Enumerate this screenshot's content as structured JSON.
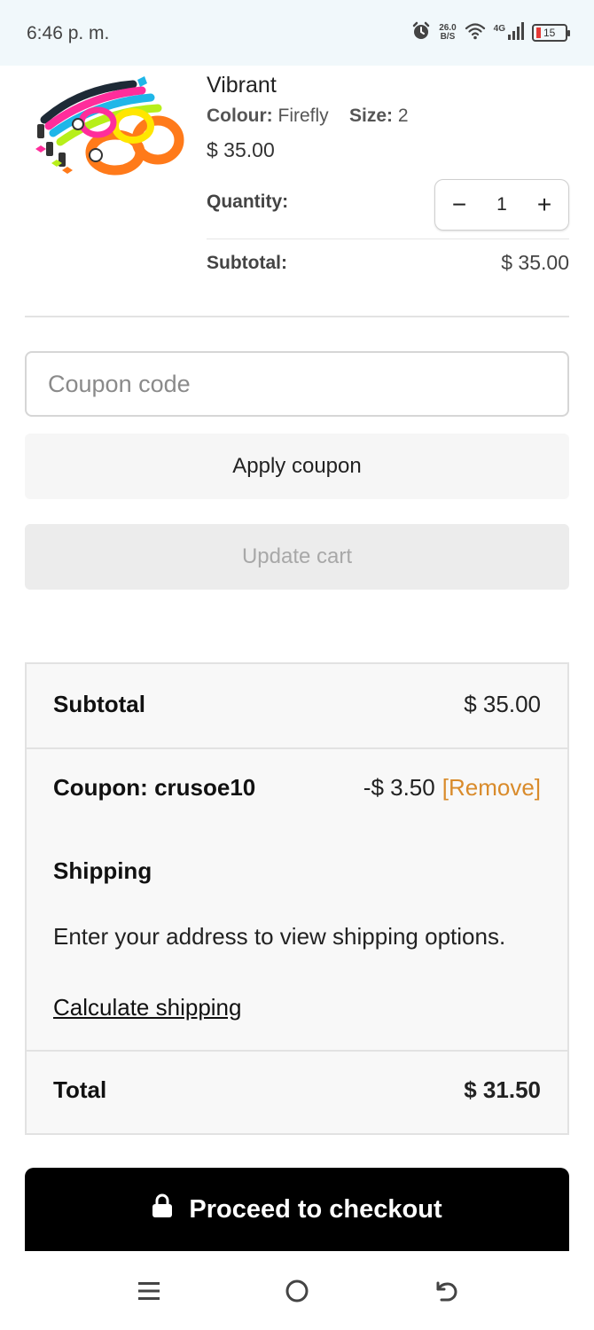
{
  "status_bar": {
    "time": "6:46 p. m.",
    "net_speed_value": "26.0",
    "net_speed_unit": "B/S",
    "network_type": "4G",
    "battery_level": "15",
    "battery_color": "#e53935"
  },
  "product": {
    "name": "Vibrant",
    "colour_label": "Colour:",
    "colour_value": "Firefly",
    "size_label": "Size:",
    "size_value": "2",
    "price": "$ 35.00",
    "quantity_label": "Quantity:",
    "quantity_value": "1",
    "decrement_symbol": "−",
    "increment_symbol": "+",
    "subtotal_label": "Subtotal:",
    "subtotal_value": "$ 35.00"
  },
  "coupon": {
    "placeholder": "Coupon code",
    "apply_label": "Apply coupon"
  },
  "update_cart_label": "Update cart",
  "totals": {
    "subtotal_label": "Subtotal",
    "subtotal_value": "$ 35.00",
    "coupon_label": "Coupon: crusoe10",
    "coupon_value": "-$ 3.50",
    "remove_label": "[Remove]",
    "shipping_title": "Shipping",
    "shipping_text": "Enter your address to view shipping options.",
    "calculate_label": "Calculate shipping",
    "total_label": "Total",
    "total_value": "$ 31.50"
  },
  "checkout": {
    "label": "Proceed to checkout",
    "icon": "lock-icon"
  },
  "nav": {
    "menu_icon": "menu-icon",
    "home_icon": "home-icon",
    "back_icon": "back-icon"
  },
  "colors": {
    "accent_link": "#d98b2b",
    "checkout_bg": "#000000",
    "status_bar_bg": "#f1f8fb"
  }
}
